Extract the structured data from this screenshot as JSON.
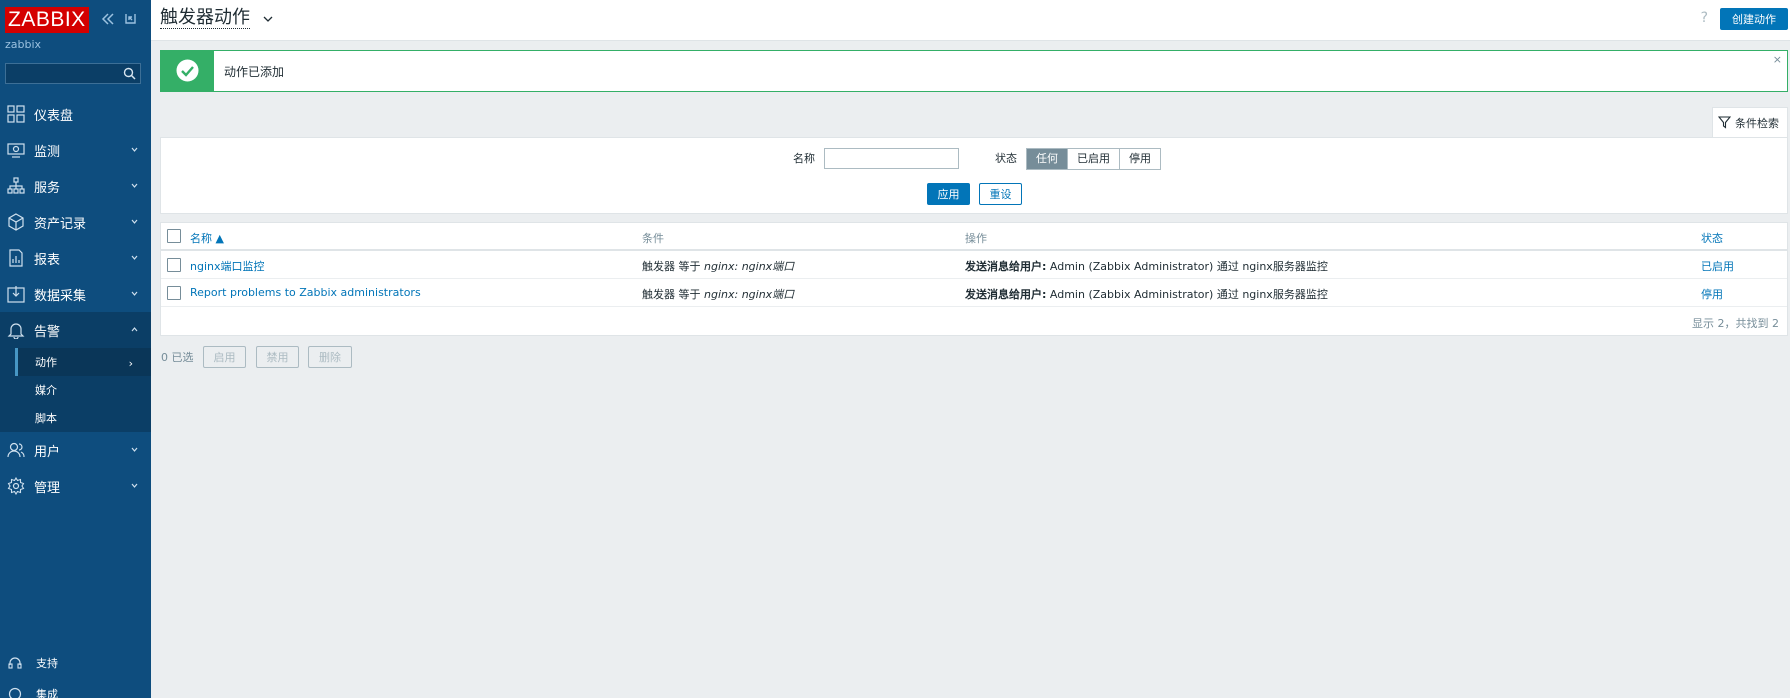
{
  "sidebar": {
    "logo": "ZABBIX",
    "server_name": "zabbix",
    "search_placeholder": "",
    "items": [
      {
        "label": "仪表盘",
        "icon": "dashboard-icon"
      },
      {
        "label": "监测",
        "icon": "monitoring-icon"
      },
      {
        "label": "服务",
        "icon": "services-icon"
      },
      {
        "label": "资产记录",
        "icon": "inventory-icon"
      },
      {
        "label": "报表",
        "icon": "reports-icon"
      },
      {
        "label": "数据采集",
        "icon": "data-collection-icon"
      },
      {
        "label": "告警",
        "icon": "alerts-icon"
      },
      {
        "label": "用户",
        "icon": "users-icon"
      },
      {
        "label": "管理",
        "icon": "administration-icon"
      }
    ],
    "alerts_sub": [
      "动作",
      "媒介",
      "脚本"
    ],
    "support": "支持",
    "integrations": "集成"
  },
  "header": {
    "title": "触发器动作",
    "help": "?",
    "create_button": "创建动作"
  },
  "message": {
    "text": "动作已添加",
    "close": "×"
  },
  "filter": {
    "tab_label": "条件检索",
    "name_label": "名称",
    "name_value": "",
    "status_label": "状态",
    "status_options": [
      "任何",
      "已启用",
      "停用"
    ],
    "status_selected": "任何",
    "apply": "应用",
    "reset": "重设"
  },
  "table": {
    "headers": {
      "name": "名称 ▲",
      "conditions": "条件",
      "operations": "操作",
      "status": "状态"
    },
    "rows": [
      {
        "name": "nginx端口监控",
        "cond_prefix": "触发器 等于 ",
        "cond_value": "nginx: nginx端口",
        "op_bold": "发送消息给用户:",
        "op_rest": " Admin (Zabbix Administrator) 通过 nginx服务器监控",
        "status": "已启用"
      },
      {
        "name": "Report problems to Zabbix administrators",
        "cond_prefix": "触发器 等于 ",
        "cond_value": "nginx: nginx端口",
        "op_bold": "发送消息给用户:",
        "op_rest": " Admin (Zabbix Administrator) 通过 nginx服务器监控",
        "status": "停用"
      }
    ],
    "pager": "显示 2，共找到 2"
  },
  "footer": {
    "selected": "0 已选",
    "enable": "启用",
    "disable": "禁用",
    "delete": "删除"
  },
  "colors": {
    "sidebar": "#0e4d7e",
    "accent": "#0275b8",
    "success": "#34af67",
    "enabled": "#429e47",
    "disabled": "#e33734"
  }
}
